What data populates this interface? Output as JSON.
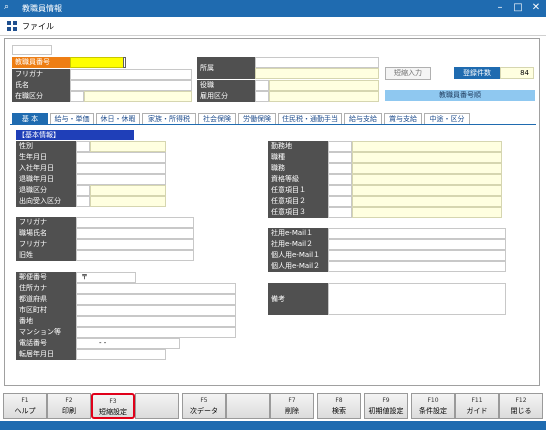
{
  "window": {
    "title": "教職員情報"
  },
  "menu": {
    "file": "ファイル"
  },
  "header": {
    "staff_no": "教職員番号",
    "furigana": "フリガナ",
    "name": "氏名",
    "status": "在職区分",
    "affiliation": "所属",
    "position": "役職",
    "employment": "雇用区分",
    "shortcut_input": "短縮入力",
    "registered_count_label": "登録件数",
    "registered_count": "84",
    "order_label": "教職員番号順"
  },
  "tabs": [
    "基 本",
    "給与・単価",
    "休日・休暇",
    "家族・所得税",
    "社会保険",
    "労働保険",
    "住民税・通勤手当",
    "給与支給",
    "賞与支給",
    "中途・区分"
  ],
  "basic": {
    "section_title": "【基本情報】",
    "gender": "性別",
    "birthdate": "生年月日",
    "hire_date": "入社年月日",
    "retire_date": "退職年月日",
    "retire_type": "退職区分",
    "secondment": "出向受入区分",
    "furigana2": "フリガナ",
    "alias_name": "職場氏名",
    "furigana3": "フリガナ",
    "old_name": "旧姓",
    "postal": "郵便番号",
    "postal_mark": "〒",
    "addr_kana": "住所カナ",
    "prefecture": "都道府県",
    "city": "市区町村",
    "street": "番地",
    "building": "マンション等",
    "phone": "電話番号",
    "phone_sep": "-   -",
    "move_date": "転居年月日",
    "workplace": "勤務地",
    "job_type": "職種",
    "job_title": "職務",
    "grade": "資格等級",
    "custom1": "任意項目１",
    "custom2": "任意項目２",
    "custom3": "任意項目３",
    "email_work1": "社用e-Mail１",
    "email_work2": "社用e-Mail２",
    "email_personal1": "個人用e-Mail１",
    "email_personal2": "個人用e-Mail２",
    "remarks": "備考"
  },
  "fkeys": [
    {
      "n": "F1",
      "l": "ヘルプ"
    },
    {
      "n": "F2",
      "l": "印刷"
    },
    {
      "n": "F3",
      "l": "短縮設定"
    },
    {
      "n": "",
      "l": ""
    },
    {
      "n": "F5",
      "l": "次データ"
    },
    {
      "n": "",
      "l": ""
    },
    {
      "n": "F7",
      "l": "削除"
    },
    {
      "n": "F8",
      "l": "検索"
    },
    {
      "n": "F9",
      "l": "初期値設定"
    },
    {
      "n": "F10",
      "l": "条件設定"
    },
    {
      "n": "F11",
      "l": "ガイド"
    },
    {
      "n": "F12",
      "l": "閉じる"
    }
  ],
  "colors": {
    "accent": "#1f6bb0",
    "highlight": "#e0001a",
    "label_bg": "#505050",
    "required": "#ffff00",
    "field_yellow": "#ffffe0"
  }
}
